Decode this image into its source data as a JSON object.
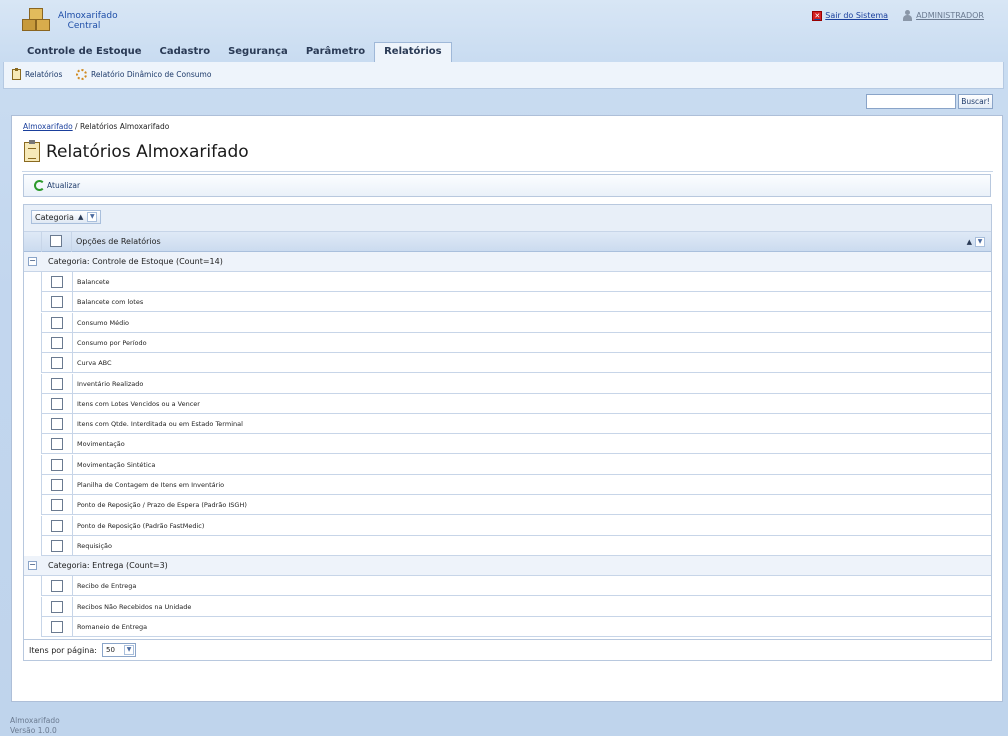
{
  "app": {
    "logo_line1": "Almoxarifado",
    "logo_line2": "Central",
    "exit_label": "Sair do Sistema",
    "user_label": "ADMINISTRADOR"
  },
  "main_tabs": [
    {
      "label": "Controle de Estoque"
    },
    {
      "label": "Cadastro"
    },
    {
      "label": "Segurança"
    },
    {
      "label": "Parâmetro"
    },
    {
      "label": "Relatórios"
    }
  ],
  "sub_nav": [
    {
      "label": "Relatórios",
      "icon": "clipboard-icon"
    },
    {
      "label": "Relatório Dinâmico de Consumo",
      "icon": "gear-icon"
    }
  ],
  "search": {
    "placeholder": "",
    "value": "",
    "button_label": "Buscar!"
  },
  "breadcrumb": {
    "root": "Almoxarifado",
    "separator": " / ",
    "current": "Relatórios Almoxarifado"
  },
  "page_title": "Relatórios Almoxarifado",
  "toolbar": {
    "refresh_label": "Atualizar"
  },
  "grid": {
    "group_by_label": "Categoria",
    "column_header": "Opções de Relatórios",
    "groups": [
      {
        "label": "Categoria: Controle de Estoque (Count=14)",
        "items": [
          "Balancete",
          "Balancete com lotes",
          "Consumo Médio",
          "Consumo por Período",
          "Curva ABC",
          "Inventário Realizado",
          "Itens com Lotes Vencidos ou a Vencer",
          "Itens com Qtde. Interditada ou em Estado Terminal",
          "Movimentação",
          "Movimentação Sintética",
          "Planilha de Contagem de Itens em Inventário",
          "Ponto de Reposição / Prazo de Espera (Padrão ISGH)",
          "Ponto de Reposição (Padrão FastMedic)",
          "Requisição"
        ]
      },
      {
        "label": "Categoria: Entrega (Count=3)",
        "items": [
          "Recibo de Entrega",
          "Recibos Não Recebidos na Unidade",
          "Romaneio de Entrega"
        ]
      }
    ],
    "pager": {
      "label": "Itens por página:",
      "value": "50"
    }
  },
  "footer": {
    "line1": "Almoxarifado",
    "line2": "Versão 1.0.0"
  },
  "colors": {
    "accent": "#1a3f9c",
    "panel_border": "#aebfd8",
    "background": "#c9dcf1"
  }
}
